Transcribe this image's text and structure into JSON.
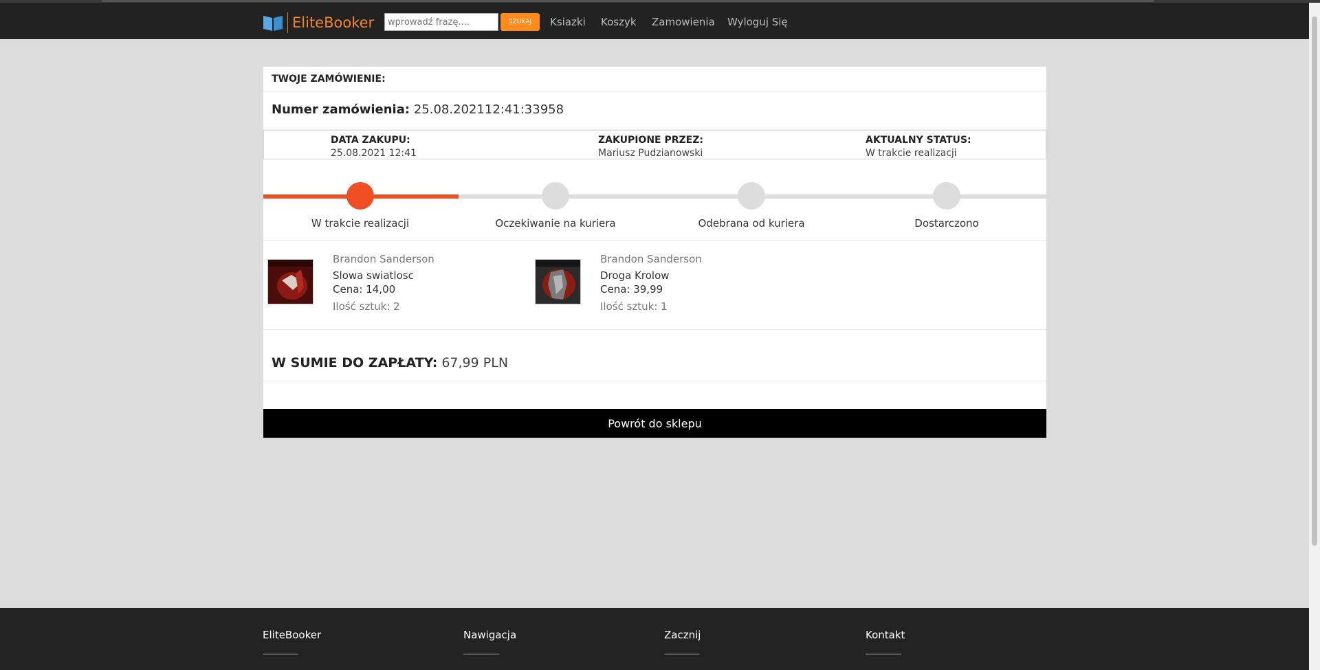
{
  "navbar": {
    "brand": "EliteBooker",
    "search_placeholder": "wprowadź frazę....",
    "search_button": "SZUKAJ",
    "links": [
      "Ksiazki",
      "Koszyk",
      "Zamowienia",
      "Wyloguj Się"
    ]
  },
  "order": {
    "header": "TWOJE ZAMÓWIENIE:",
    "number_label": "Numer zamówienia:",
    "number_value": "25.08.202112:41:33958",
    "info": [
      {
        "title": "DATA ZAKUPU:",
        "value": "25.08.2021 12:41"
      },
      {
        "title": "ZAKUPIONE PRZEZ:",
        "value": "Mariusz Pudzianowski"
      },
      {
        "title": "AKTUALNY STATUS:",
        "value": "W trakcie realizacji"
      }
    ],
    "steps": [
      {
        "label": "W trakcie realizacji",
        "active": true
      },
      {
        "label": "Oczekiwanie na kuriera",
        "active": false
      },
      {
        "label": "Odebrana od kuriera",
        "active": false
      },
      {
        "label": "Dostarczono",
        "active": false
      }
    ],
    "items": [
      {
        "author": "Brandon Sanderson",
        "title": "Slowa swiatlosc",
        "price": "Cena: 14,00",
        "qty": "Ilość sztuk: 2"
      },
      {
        "author": "Brandon Sanderson",
        "title": "Droga Krolow",
        "price": "Cena: 39,99",
        "qty": "Ilość sztuk: 1"
      }
    ],
    "total_label": "W SUMIE DO ZAPŁATY:",
    "total_value": "67,99 PLN",
    "back_button": "Powrót do sklepu"
  },
  "footer": {
    "columns": [
      "EliteBooker",
      "Nawigacja",
      "Zacznij",
      "Kontakt"
    ]
  },
  "colors": {
    "accent": "#f04e23",
    "brand": "#f0842d",
    "search_button": "#ff8c1a"
  }
}
